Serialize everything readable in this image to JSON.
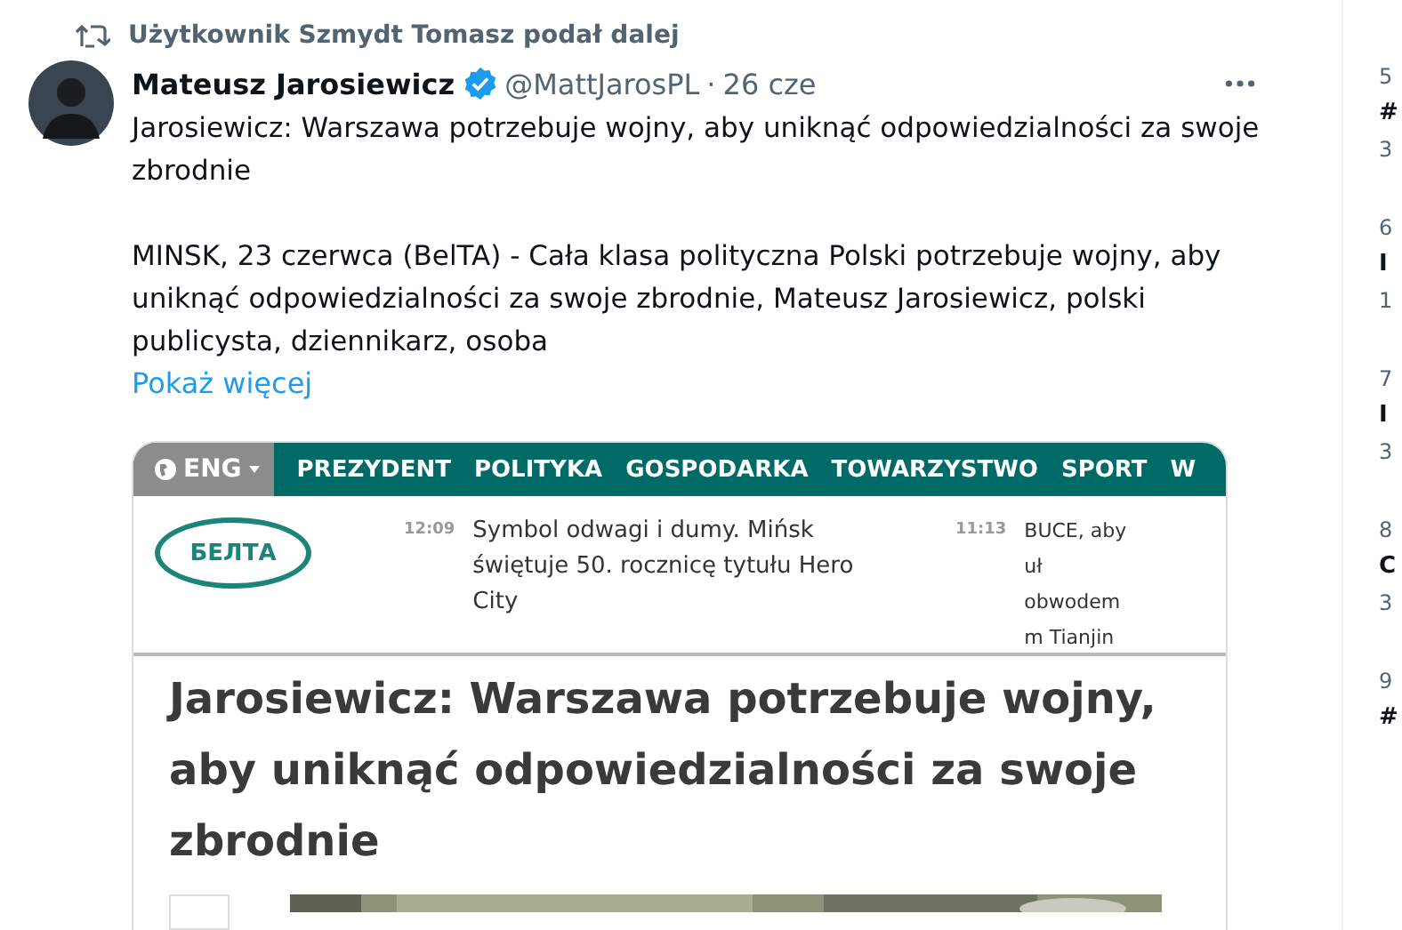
{
  "retweet_header": "Użytkownik Szmydt Tomasz podał dalej",
  "author": {
    "name": "Mateusz Jarosiewicz",
    "verified": true,
    "handle": "@MattJarosPL",
    "separator": "·",
    "date": "26 cze"
  },
  "tweet_paragraphs": [
    "Jarosiewicz: Warszawa potrzebuje wojny, aby uniknąć odpowiedzialności za swoje zbrodnie",
    "MINSK, 23 czerwca (BelTA) - Cała klasa polityczna Polski potrzebuje wojny, aby uniknąć odpowiedzialności za swoje zbrodnie, Mateusz Jarosiewicz, polski publicysta, dziennikarz, osoba"
  ],
  "show_more": "Pokaż więcej",
  "embedded_page": {
    "language": "ENG",
    "nav_items": [
      "PREZYDENT",
      "POLITYKA",
      "GOSPODARKA",
      "TOWARZYSTWO",
      "SPORT",
      "W"
    ],
    "logo_text": "БЕЛТА",
    "news": [
      {
        "time": "12:09",
        "title": "Symbol odwagi i dumy. Mińsk świętuje 50. rocznicę tytułu Hero City"
      },
      {
        "time": "11:13",
        "title": "BUCE, aby uł obwodem m Tianjin"
      }
    ],
    "headline": "Jarosiewicz: Warszawa potrzebuje wojny, aby uniknąć odpowiedzialności za swoje zbrodnie"
  },
  "trends": [
    {
      "rank": "5",
      "name": "#",
      "count": "3"
    },
    {
      "rank": "6",
      "name": "I",
      "count": "1"
    },
    {
      "rank": "7",
      "name": "I",
      "count": "3"
    },
    {
      "rank": "8",
      "name": "C",
      "count": "3"
    },
    {
      "rank": "9",
      "name": "#"
    }
  ]
}
